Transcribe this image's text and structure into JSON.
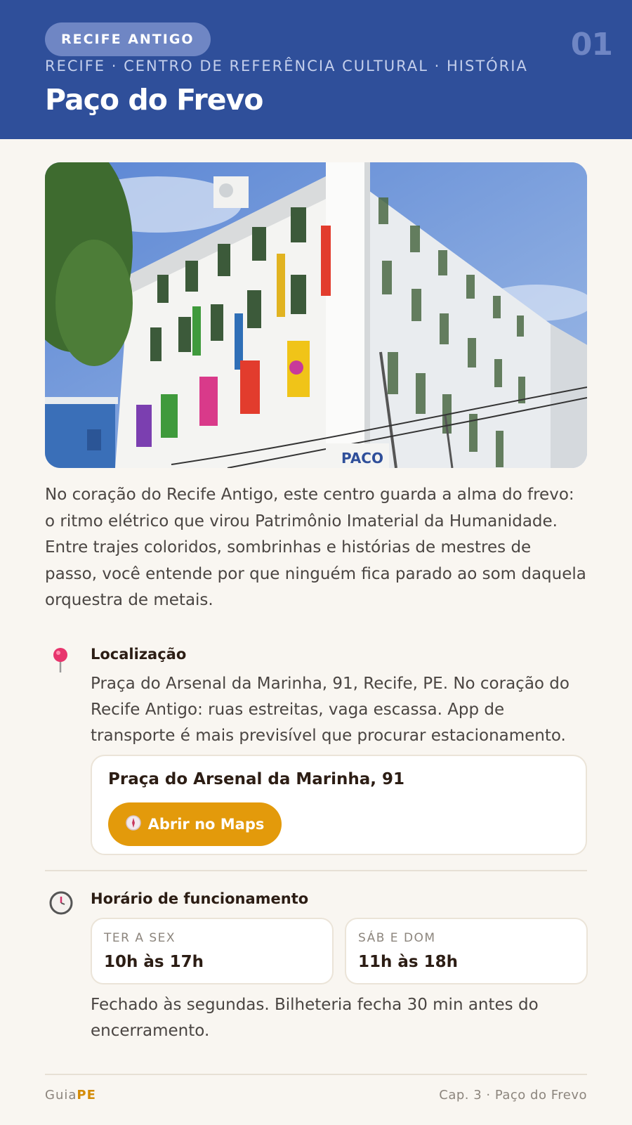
{
  "header": {
    "region_badge": "RECIFE ANTIGO",
    "chapter_number": "01",
    "subtitle": "RECIFE · CENTRO DE REFERÊNCIA CULTURAL · HISTÓRIA",
    "title": "Paço do Frevo"
  },
  "photo": {
    "building_sign": "PACO"
  },
  "intro": "No coração do Recife Antigo, este centro guarda a alma do frevo: o ritmo elétrico que virou Patrimônio Imaterial da Humanidade. Entre trajes coloridos, sombrinhas e histórias de mestres de passo, você entende por que ninguém fica parado ao som daquela orquestra de metais.",
  "location": {
    "icon": "map-pin-icon",
    "title": "Localização",
    "text": "Praça do Arsenal da Marinha, 91, Recife, PE. No coração do Recife Antigo: ruas estreitas, vaga escassa. App de transporte é mais previsível que procurar estacionamento.",
    "address": "Praça do Arsenal da Marinha, 91",
    "maps_button_label": "Abrir no Maps",
    "maps_button_icon": "compass-icon"
  },
  "hours": {
    "icon": "clock-icon",
    "title": "Horário de funcionamento",
    "slots": [
      {
        "days": "TER A SEX",
        "time": "10h às 17h"
      },
      {
        "days": "SÁB E DOM",
        "time": "11h às 18h"
      }
    ],
    "note": "Fechado às segundas. Bilheteria fecha 30 min antes do encerramento."
  },
  "footer": {
    "brand_prefix": "Guia",
    "brand_suffix": "PE",
    "chapter": "Cap. 3 · Paço do Frevo"
  },
  "colors": {
    "header_bg": "#2f4f9a",
    "badge_bg": "#6f86c4",
    "accent": "#e39a0b",
    "page_bg": "#f9f6f1"
  }
}
